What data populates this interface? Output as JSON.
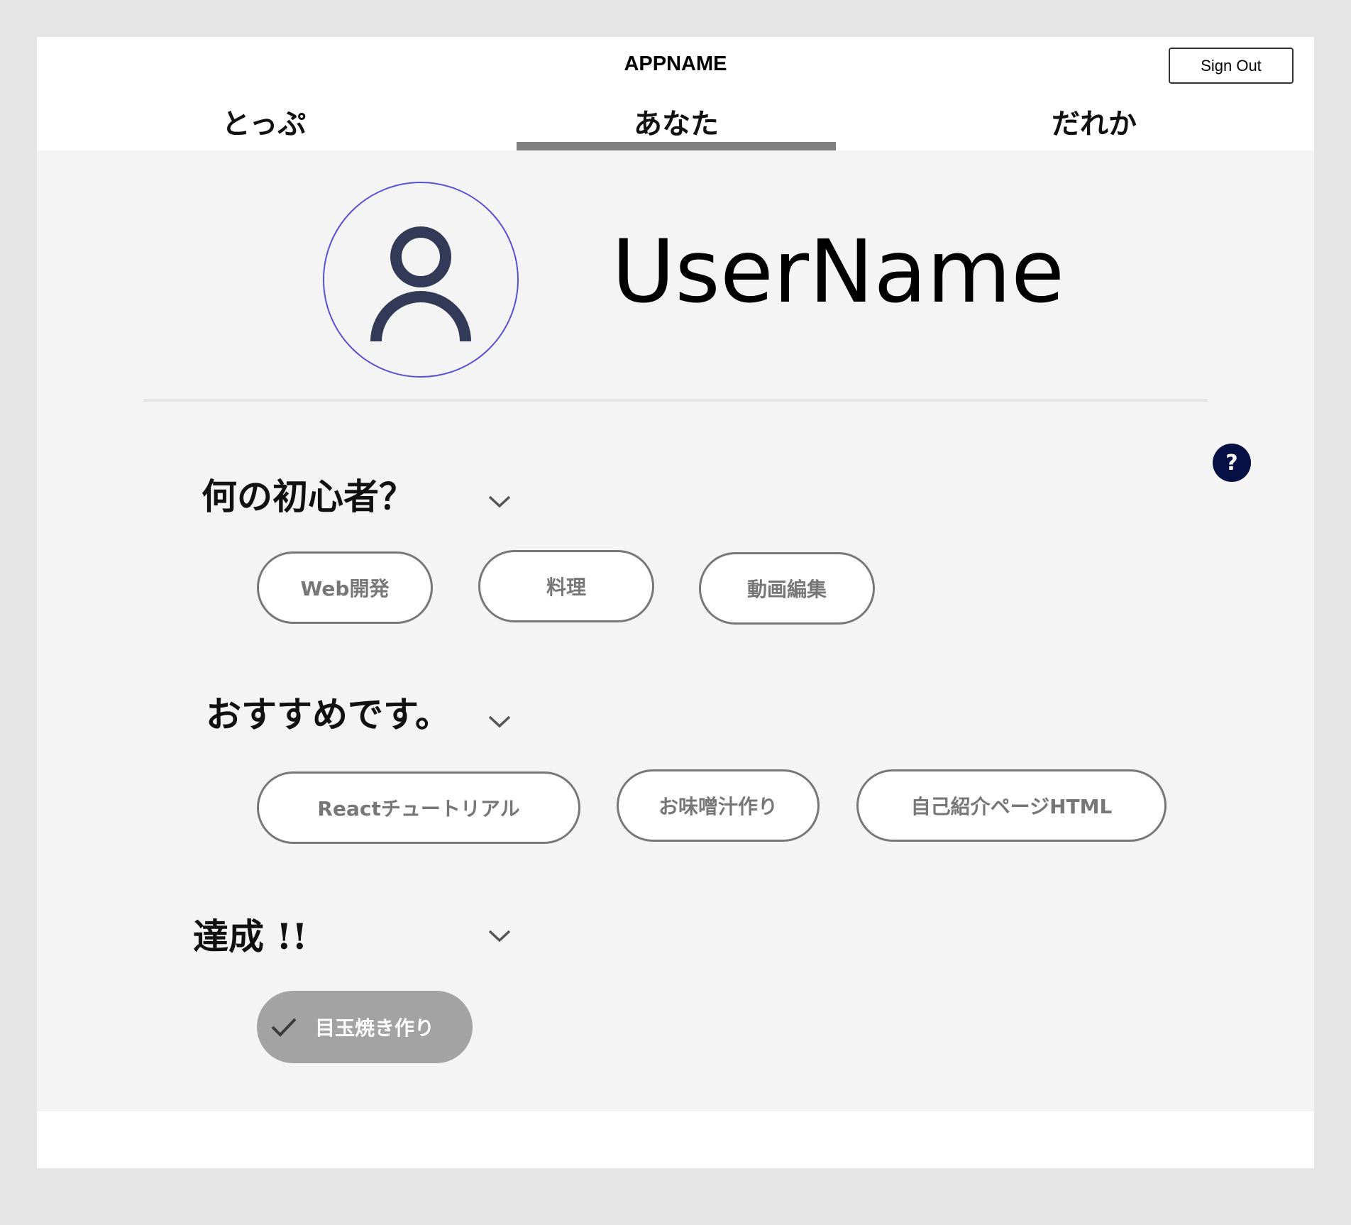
{
  "header": {
    "app_name": "APPNAME",
    "sign_out_label": "Sign Out",
    "tabs": [
      {
        "label": "とっぷ",
        "active": false
      },
      {
        "label": "あなた",
        "active": true
      },
      {
        "label": "だれか",
        "active": false
      }
    ]
  },
  "profile": {
    "username": "UserName",
    "avatar_icon": "user-icon"
  },
  "help": {
    "label": "?"
  },
  "sections": [
    {
      "title": "何の初心者？",
      "chips": [
        "Web開発",
        "料理",
        "動画編集"
      ]
    },
    {
      "title": "おすすめです。",
      "chips": [
        "Reactチュートリアル",
        "お味噌汁作り",
        "自己紹介ページHTML"
      ]
    },
    {
      "title": "達成 !!",
      "chips": [
        "目玉焼き作り"
      ],
      "completed": true
    }
  ],
  "colors": {
    "accent_underline": "#808080",
    "avatar_border": "#5b4fd6",
    "avatar_icon": "#333a57",
    "help_button": "#061044",
    "chip_border": "#777777",
    "completed_chip": "#a3a3a3"
  }
}
